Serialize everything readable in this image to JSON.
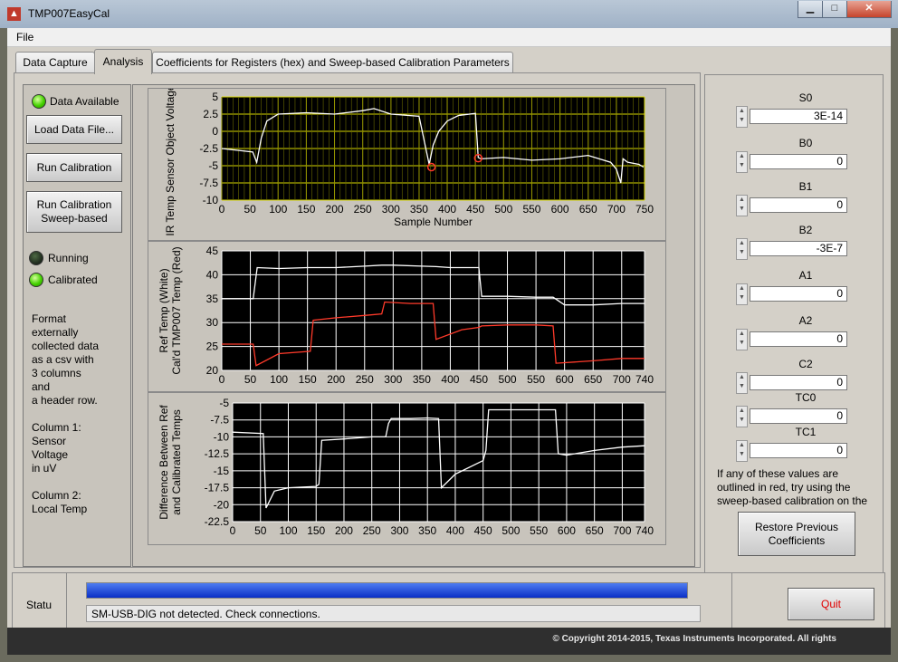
{
  "window": {
    "title": "TMP007EasyCal"
  },
  "menu": {
    "file": "File"
  },
  "tabs": [
    {
      "label": "Data Capture"
    },
    {
      "label": "Analysis",
      "active": true
    },
    {
      "label": "Coefficients for Registers (hex) and Sweep-based Calibration Parameters"
    }
  ],
  "left": {
    "data_available": "Data Available",
    "load_button": "Load Data File...",
    "run_button": "Run Calibration",
    "run_sweep_button": "Run Calibration\nSweep-based",
    "running": "Running",
    "calibrated": "Calibrated",
    "format_text": "Format\nexternally\ncollected data\nas a csv with\n3 columns\nand\na header row.\n\nColumn 1:\nSensor\nVoltage\nin uV\n\nColumn 2:\nLocal Temp"
  },
  "coefficients": [
    {
      "label": "S0",
      "value": "3E-14"
    },
    {
      "label": "B0",
      "value": "0"
    },
    {
      "label": "B1",
      "value": "0"
    },
    {
      "label": "B2",
      "value": "-3E-7"
    },
    {
      "label": "A1",
      "value": "0"
    },
    {
      "label": "A2",
      "value": "0"
    },
    {
      "label": "C2",
      "value": "0"
    },
    {
      "label": "TC0",
      "value": "0"
    },
    {
      "label": "TC1",
      "value": "0"
    }
  ],
  "coef_note": "If any of these values are outlined in red, try using the sweep-based calibration on the",
  "restore_button": "Restore Previous\nCoefficients",
  "status": {
    "label": "Statu",
    "message": "SM-USB-DIG not detected. Check connections.",
    "progress": 1.0
  },
  "quit_button": "Quit",
  "copyright": "© Copyright 2014-2015, Texas Instruments Incorporated. All rights",
  "colors": {
    "led_on": "#44d200",
    "plot_bg": "#000000",
    "grid1": "#d8d800",
    "grid_white": "#ffffff",
    "red_trace": "#ff3a2a",
    "progress": "#1040d8"
  },
  "chart_data": [
    {
      "type": "line",
      "xlabel": "Sample Number",
      "ylabel": "IR Temp Sensor Object Voltage (uV)",
      "xlim": [
        0,
        750
      ],
      "ylim": [
        -10,
        5
      ],
      "xticks": [
        0,
        50,
        100,
        150,
        200,
        250,
        300,
        350,
        400,
        450,
        500,
        550,
        600,
        650,
        700,
        750
      ],
      "yticks": [
        5,
        2.5,
        0,
        -2.5,
        -5,
        -7.5,
        -10
      ],
      "series": [
        {
          "x": [
            0,
            55,
            62,
            70,
            80,
            100,
            150,
            200,
            250,
            270,
            300,
            350,
            368,
            375,
            385,
            400,
            420,
            450,
            455,
            460,
            500,
            550,
            600,
            650,
            690,
            700,
            708,
            712,
            720,
            740,
            748
          ],
          "y": [
            -2.5,
            -3,
            -4.5,
            -1,
            1.5,
            2.5,
            2.7,
            2.5,
            3,
            3.3,
            2.5,
            2.2,
            -4.8,
            -2,
            0,
            1.5,
            2.3,
            2.6,
            -3.8,
            -4,
            -3.8,
            -4.2,
            -4,
            -3.5,
            -4.5,
            -5.5,
            -7.5,
            -4,
            -4.5,
            -4.8,
            -5.2
          ]
        }
      ],
      "markers": [
        {
          "x": 372,
          "y": -5.2
        },
        {
          "x": 455,
          "y": -3.9
        }
      ]
    },
    {
      "type": "line",
      "ylabel": "Ref Temp (White)\nCal'd TMP007 Temp (Red)",
      "xlim": [
        0,
        740
      ],
      "ylim": [
        20,
        45
      ],
      "xticks": [
        0,
        50,
        100,
        150,
        200,
        250,
        300,
        350,
        400,
        450,
        500,
        550,
        600,
        650,
        700,
        740
      ],
      "yticks": [
        45,
        40,
        35,
        30,
        25,
        20
      ],
      "series": [
        {
          "color": "white",
          "x": [
            0,
            55,
            62,
            100,
            150,
            200,
            250,
            280,
            300,
            350,
            375,
            400,
            450,
            455,
            500,
            550,
            580,
            600,
            650,
            700,
            740
          ],
          "y": [
            35,
            35,
            41.5,
            41.3,
            41.5,
            41.5,
            41.8,
            42,
            42,
            41.8,
            41.7,
            41.5,
            41.5,
            35.5,
            35.5,
            35.3,
            35.3,
            33.7,
            33.7,
            34,
            34
          ]
        },
        {
          "color": "red",
          "x": [
            0,
            55,
            60,
            100,
            155,
            160,
            200,
            250,
            280,
            285,
            330,
            370,
            375,
            420,
            450,
            455,
            500,
            550,
            580,
            585,
            650,
            700,
            740
          ],
          "y": [
            25.5,
            25.5,
            21,
            23.5,
            24,
            30.5,
            31,
            31.5,
            31.8,
            34.3,
            34,
            34,
            26.5,
            28.5,
            29,
            29.3,
            29.5,
            29.5,
            29.3,
            21.5,
            22,
            22.5,
            22.5
          ]
        }
      ]
    },
    {
      "type": "line",
      "ylabel": "Difference Between Ref\nand Calibrated Temps",
      "xlim": [
        0,
        740
      ],
      "ylim": [
        -22.5,
        -5
      ],
      "xticks": [
        0,
        50,
        100,
        150,
        200,
        250,
        300,
        350,
        400,
        450,
        500,
        550,
        600,
        650,
        700,
        740
      ],
      "yticks": [
        -5,
        -7.5,
        -10,
        -12.5,
        -15,
        -17.5,
        -20,
        -22.5
      ],
      "series": [
        {
          "x": [
            0,
            55,
            60,
            75,
            100,
            150,
            155,
            160,
            200,
            250,
            275,
            280,
            285,
            320,
            350,
            370,
            375,
            400,
            450,
            455,
            460,
            500,
            550,
            580,
            585,
            600,
            650,
            700,
            740
          ],
          "y": [
            -9.3,
            -9.5,
            -20.5,
            -18,
            -17.5,
            -17.3,
            -17,
            -10.5,
            -10.3,
            -10,
            -10,
            -8,
            -7.3,
            -7.3,
            -7.2,
            -7.3,
            -17.5,
            -15.5,
            -13.5,
            -12,
            -6,
            -6,
            -6,
            -6,
            -12.5,
            -12.7,
            -12,
            -11.5,
            -11.3
          ]
        }
      ]
    }
  ]
}
